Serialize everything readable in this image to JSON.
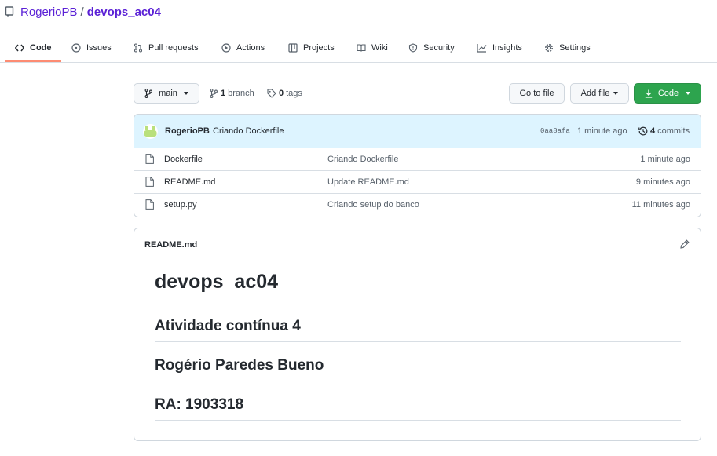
{
  "repo": {
    "owner": "RogerioPB",
    "separator": "/",
    "name": "devops_ac04"
  },
  "tabs": [
    {
      "label": "Code",
      "icon": "code-icon",
      "selected": true
    },
    {
      "label": "Issues",
      "icon": "issue-icon"
    },
    {
      "label": "Pull requests",
      "icon": "pull-request-icon"
    },
    {
      "label": "Actions",
      "icon": "play-icon"
    },
    {
      "label": "Projects",
      "icon": "table-icon"
    },
    {
      "label": "Wiki",
      "icon": "book-icon"
    },
    {
      "label": "Security",
      "icon": "shield-icon"
    },
    {
      "label": "Insights",
      "icon": "graph-icon"
    },
    {
      "label": "Settings",
      "icon": "gear-icon"
    }
  ],
  "branchbar": {
    "branch": "main",
    "branch_count": "1",
    "branch_label": "branch",
    "tag_count": "0",
    "tag_label": "tags",
    "go_to_file": "Go to file",
    "add_file": "Add file",
    "code": "Code"
  },
  "commit": {
    "author": "RogerioPB",
    "message": "Criando Dockerfile",
    "sha": "0aa8afa",
    "time": "1 minute ago",
    "count": "4",
    "count_label": "commits"
  },
  "files": [
    {
      "name": "Dockerfile",
      "message": "Criando Dockerfile",
      "age": "1 minute ago"
    },
    {
      "name": "README.md",
      "message": "Update README.md",
      "age": "9 minutes ago"
    },
    {
      "name": "setup.py",
      "message": "Criando setup do banco",
      "age": "11 minutes ago"
    }
  ],
  "readme": {
    "title": "README.md",
    "h1": "devops_ac04",
    "h2": [
      "Atividade contínua 4",
      "Rogério Paredes Bueno",
      "RA: 1903318"
    ]
  },
  "colors": {
    "accent_link": "#5b21d6",
    "tab_underline": "#fd8c73",
    "primary_button": "#2da44e",
    "commit_bg": "#ddf4ff"
  }
}
